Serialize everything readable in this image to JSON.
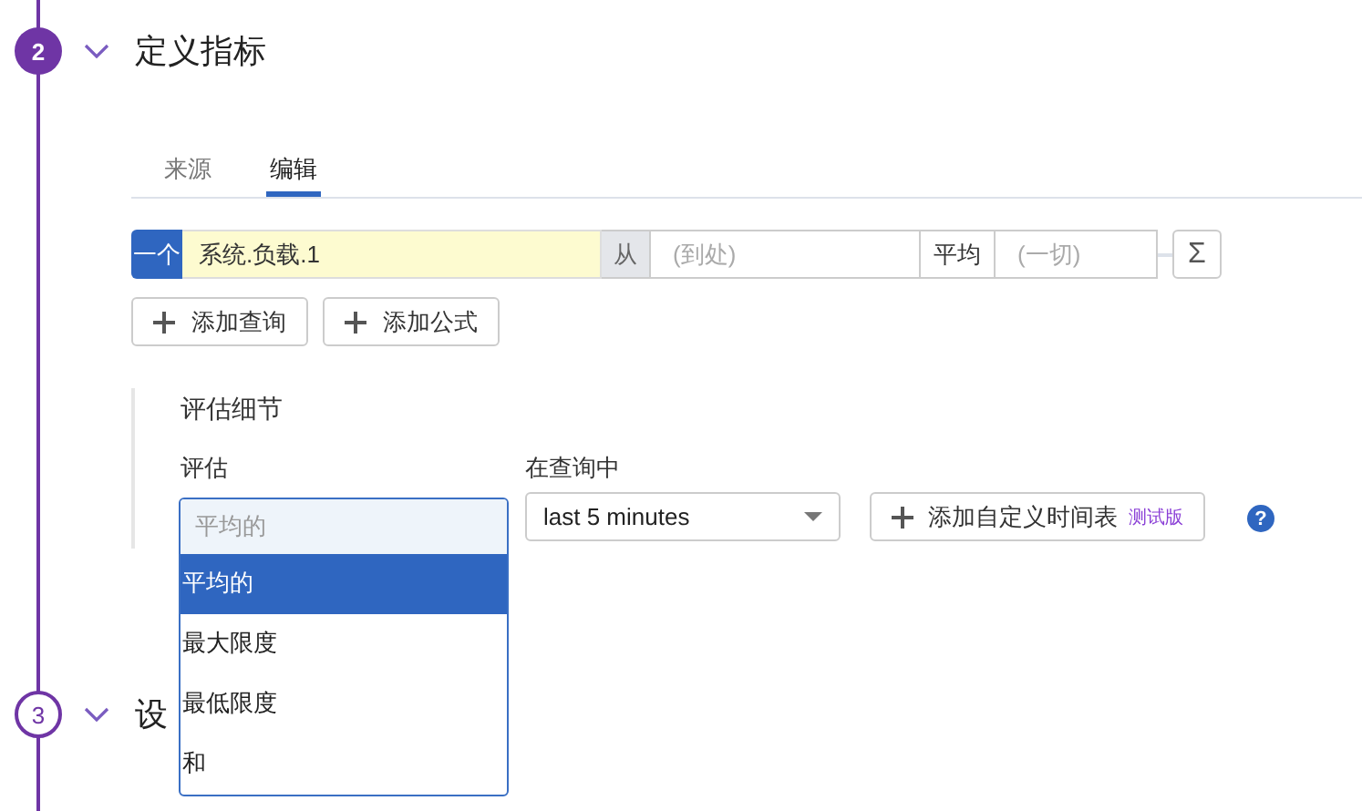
{
  "steps": [
    {
      "number": "2",
      "title": "定义指标",
      "active": true
    },
    {
      "number": "3",
      "title": "设",
      "active": false
    }
  ],
  "tabs": [
    {
      "label": "来源",
      "selected": false
    },
    {
      "label": "编辑",
      "selected": true
    }
  ],
  "query": {
    "tag": "一个",
    "metric": "系统.负载.1",
    "from_label": "从",
    "from_placeholder": "(到处)",
    "agg_label": "平均",
    "by_placeholder": "(一切)",
    "sigma": "Σ"
  },
  "query_buttons": [
    "添加查询",
    "添加公式"
  ],
  "evaluation": {
    "title": "评估细节",
    "eval_label": "评估",
    "eval_placeholder": "平均的",
    "window_label": "在查询中",
    "window_value": "last 5 minutes",
    "schedule_button": "添加自定义时间表",
    "beta": "测试版",
    "help": "?",
    "options": [
      {
        "label": "平均的",
        "selected": true
      },
      {
        "label": "最大限度",
        "selected": false
      },
      {
        "label": "最低限度",
        "selected": false
      },
      {
        "label": "和",
        "selected": false
      }
    ]
  }
}
